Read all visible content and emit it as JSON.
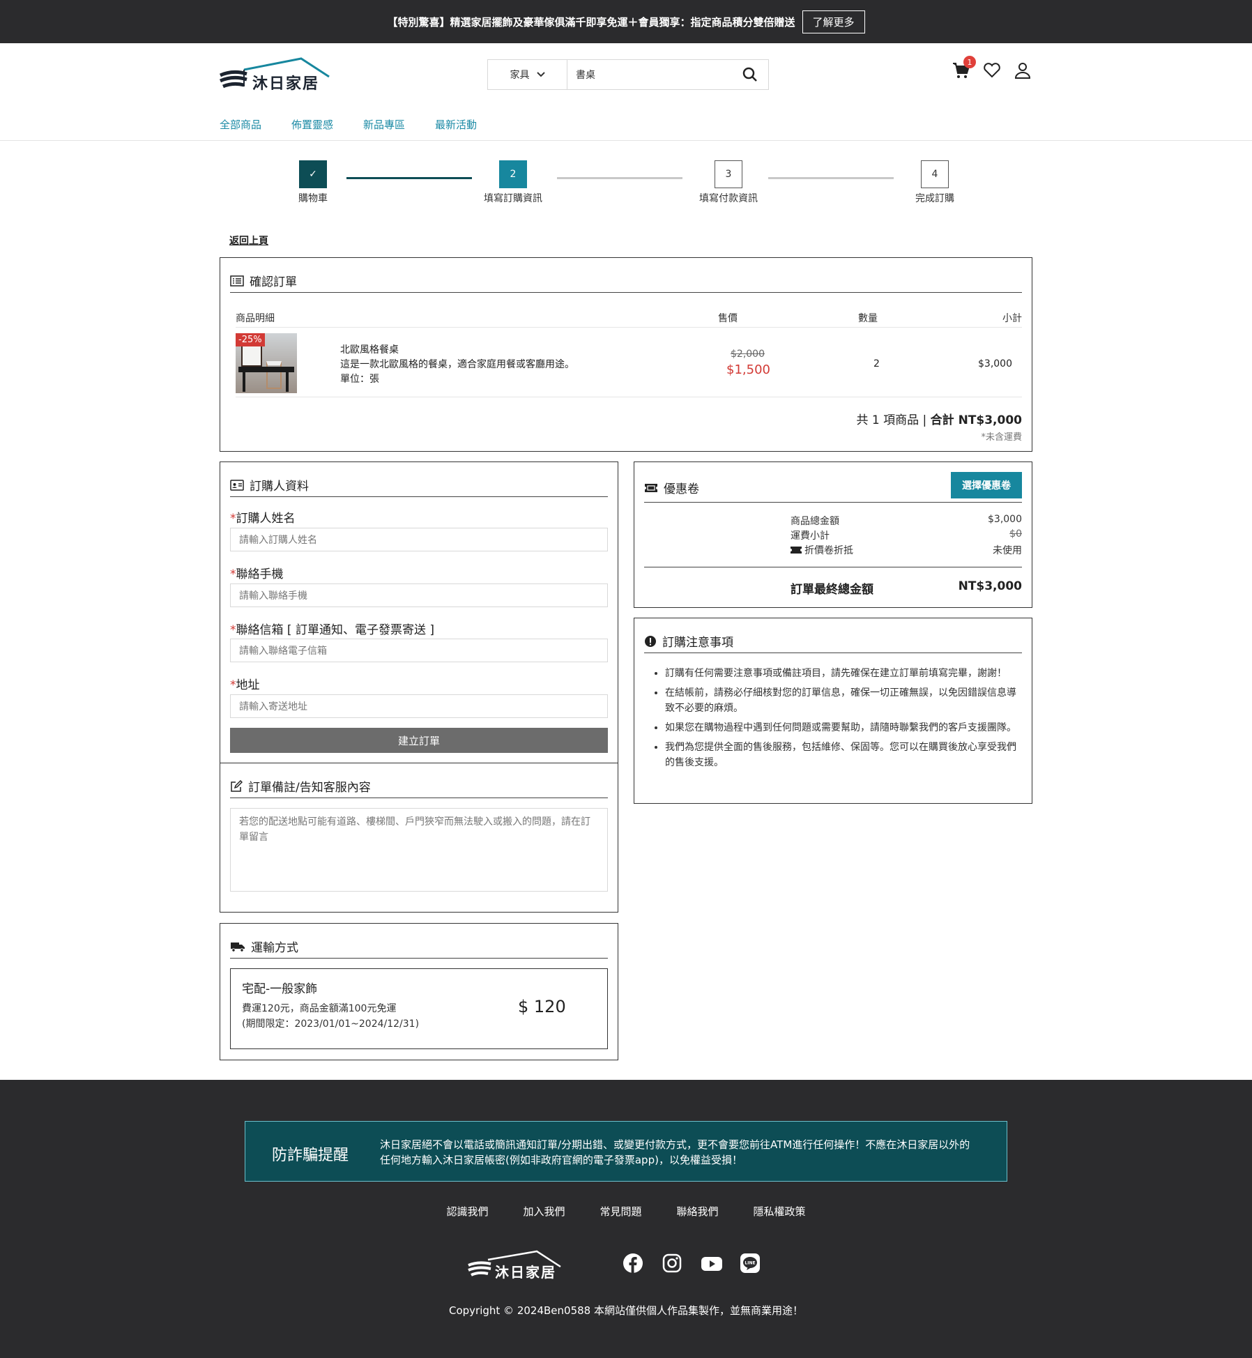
{
  "promo": {
    "text": "【特別驚喜】精選家居擺飾及豪華傢俱滿千即享免運＋會員獨享：指定商品積分雙倍贈送",
    "button": "了解更多"
  },
  "brand": {
    "name": "沐日家居",
    "accent": "#17879e",
    "dark": "#2b2b2d"
  },
  "search": {
    "category": "家具",
    "value": "書桌"
  },
  "cart": {
    "count": "1"
  },
  "nav": [
    "全部商品",
    "佈置靈感",
    "新品專區",
    "最新活動"
  ],
  "steps": [
    {
      "num": "✓",
      "label": "購物車"
    },
    {
      "num": "2",
      "label": "填寫訂購資訊"
    },
    {
      "num": "3",
      "label": "填寫付款資訊"
    },
    {
      "num": "4",
      "label": "完成訂購"
    }
  ],
  "back": "返回上頁",
  "order": {
    "title": "確認訂單",
    "headers": {
      "item": "商品明細",
      "price": "售價",
      "qty": "數量",
      "subtotal": "小計"
    },
    "item": {
      "badge": "-25%",
      "name": "北歐風格餐桌",
      "desc": "這是一款北歐風格的餐桌，適合家庭用餐或客廳用途。",
      "unit": "單位：張",
      "old_price": "$2,000",
      "price": "$1,500",
      "qty": "2",
      "subtotal": "$3,000"
    },
    "summary_count": "共 1 項商品 | ",
    "summary_total": "合計 NT$3,000",
    "note": "*未含運費"
  },
  "buyer": {
    "title": "訂購人資料",
    "fields": [
      {
        "label": "訂購人姓名",
        "placeholder": "請輸入訂購人姓名"
      },
      {
        "label": "聯絡手機",
        "placeholder": "請輸入聯絡手機"
      },
      {
        "label": "聯絡信箱 [ 訂單通知、電子發票寄送 ]",
        "placeholder": "請輸入聯絡電子信箱"
      },
      {
        "label": "地址",
        "placeholder": "請輸入寄送地址"
      }
    ],
    "submit": "建立訂單"
  },
  "remark": {
    "title": "訂單備註/告知客服內容",
    "placeholder": "若您的配送地點可能有道路、樓梯間、戶門狹窄而無法駛入或搬入的問題，請在訂單留言"
  },
  "shipping": {
    "title": "運輸方式",
    "name": "宅配-一般家飾",
    "desc1": "費運120元，商品金額滿100元免運",
    "desc2": "(期間限定：2023/01/01~2024/12/31)",
    "price": "$ 120"
  },
  "coupon": {
    "title": "優惠卷",
    "button": "選擇優惠卷",
    "rows": [
      {
        "label": "商品總金額",
        "value": "$3,000"
      },
      {
        "label": "運費小計",
        "value": "$0"
      },
      {
        "label": "折價卷折抵",
        "value": "未使用"
      }
    ],
    "total_label": "訂單最終總金額",
    "total_value": "NT$3,000"
  },
  "notice": {
    "title": "訂購注意事項",
    "items": [
      "訂購有任何需要注意事項或備註項目，請先確保在建立訂單前填寫完畢，謝謝！",
      "在結帳前，請務必仔細核對您的訂單信息，確保一切正確無誤，以免因錯誤信息導致不必要的麻煩。",
      "如果您在購物過程中遇到任何問題或需要幫助，請隨時聯繫我們的客戶支援團隊。",
      "我們為您提供全面的售後服務，包括維修、保固等。您可以在購買後放心享受我們的售後支援。"
    ]
  },
  "footer": {
    "fraud_title": "防詐騙提醒",
    "fraud_text": "沐日家居絕不會以電話或簡訊通知訂單/分期出錯、或變更付款方式，更不會要您前往ATM進行任何操作！不應在沐日家居以外的任何地方輸入沐日家居帳密(例如非政府官網的電子發票app)，以免權益受損！",
    "links": [
      "認識我們",
      "加入我們",
      "常見問題",
      "聯絡我們",
      "隱私權政策"
    ],
    "social_icons": [
      "facebook-icon",
      "instagram-icon",
      "youtube-icon",
      "line-icon"
    ],
    "copyright": "Copyright © 2024Ben0588 本網站僅供個人作品集製作，並無商業用途！"
  }
}
